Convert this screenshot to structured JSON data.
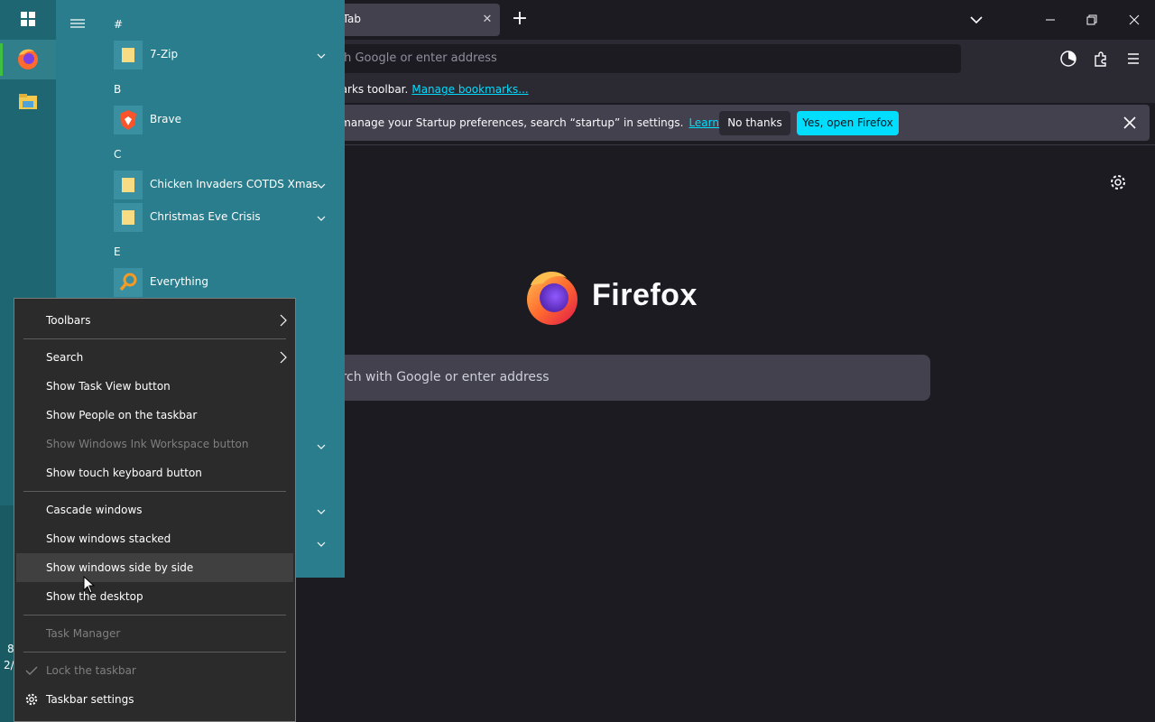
{
  "firefox": {
    "tab_title": "w Tab",
    "url_placeholder": "th Google or enter address",
    "bookmarks_text": "marks toolbar.",
    "bookmarks_link": "Manage bookmarks...",
    "notice_text": "o manage your Startup preferences, search “startup” in settings.",
    "notice_link": "Learn more",
    "no_thanks": "No thanks",
    "yes_open": "Yes, open Firefox",
    "wordmark": "Firefox",
    "search_placeholder": "arch with Google or enter address",
    "accent": "#00ddff"
  },
  "start_menu": {
    "groups": [
      {
        "letter": "#",
        "apps": [
          {
            "name": "7-Zip",
            "icon": "folder-icon",
            "expandable": true
          }
        ]
      },
      {
        "letter": "B",
        "apps": [
          {
            "name": "Brave",
            "icon": "brave-icon",
            "expandable": false
          }
        ]
      },
      {
        "letter": "C",
        "apps": [
          {
            "name": "Chicken Invaders COTDS Xmas",
            "icon": "folder-icon",
            "expandable": true
          },
          {
            "name": "Christmas Eve Crisis",
            "icon": "folder-icon",
            "expandable": true
          }
        ]
      },
      {
        "letter": "E",
        "apps": [
          {
            "name": "Everything",
            "icon": "search-magnifier-icon",
            "expandable": false
          }
        ]
      }
    ],
    "rail_icons": [
      "windows-icon",
      "firefox-icon",
      "file-explorer-icon"
    ],
    "desktop_chars": [
      "8",
      "2/"
    ]
  },
  "context_menu": {
    "items": [
      {
        "label": "Toolbars",
        "submenu": true,
        "enabled": true
      },
      {
        "label": "Search",
        "submenu": true,
        "enabled": true
      },
      {
        "label": "Show Task View button",
        "enabled": true
      },
      {
        "label": "Show People on the taskbar",
        "enabled": true
      },
      {
        "label": "Show Windows Ink Workspace button",
        "enabled": false
      },
      {
        "label": "Show touch keyboard button",
        "enabled": true
      },
      {
        "label": "Cascade windows",
        "enabled": true
      },
      {
        "label": "Show windows stacked",
        "enabled": true
      },
      {
        "label": "Show windows side by side",
        "enabled": true,
        "hovered": true
      },
      {
        "label": "Show the desktop",
        "enabled": true
      },
      {
        "label": "Task Manager",
        "enabled": false
      },
      {
        "label": "Lock the taskbar",
        "enabled": false,
        "checked": true
      },
      {
        "label": "Taskbar settings",
        "enabled": true,
        "icon": "gear-icon"
      }
    ]
  }
}
